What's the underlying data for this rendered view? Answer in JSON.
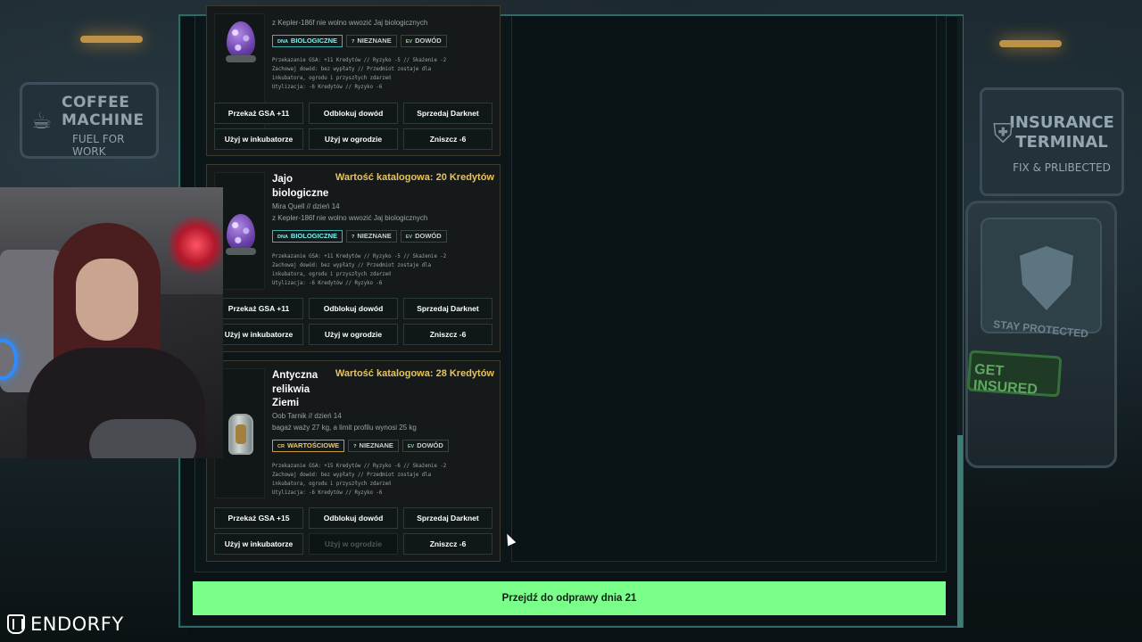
{
  "background": {
    "coffee_sign": {
      "line1": "COFFEE MACHINE",
      "line2": "FUEL FOR WORK"
    },
    "insurance_sign": {
      "line1": "INSURANCE",
      "line2": "TERMINAL",
      "line3": "FIX & PRLIBECTED"
    },
    "insurance_machine": {
      "stay": "STAY PROTECTED",
      "get": "GET INSURED"
    }
  },
  "brand": {
    "name": "ENDORFY"
  },
  "cards": [
    {
      "title": "",
      "value": "",
      "owner": "",
      "rule": "z Kepler-186f nie wolno wwozić Jaj biologicznych",
      "tags": [
        {
          "icon": "DNA",
          "label": "BIOLOGICZNE",
          "kind": "bio"
        },
        {
          "icon": "?",
          "label": "NIEZNANE",
          "kind": "unknown"
        },
        {
          "icon": "EV",
          "label": "DOWÓD",
          "kind": "ev"
        }
      ],
      "desc": [
        "Przekazanie GSA: +11 Kredytów // Ryzyko -5 // Skażenie -2",
        "Zachowaj dowód: bez wypłaty // Przedmiot zostaje dla",
        "inkubatora, ogrodu i przyszłych zdarzeń",
        "Utylizacja: -6 Kredytów // Ryzyko -6"
      ],
      "buttons": [
        {
          "label": "Przekaż GSA +11",
          "enabled": true
        },
        {
          "label": "Odblokuj dowód",
          "enabled": true
        },
        {
          "label": "Sprzedaj Darknet",
          "enabled": true
        },
        {
          "label": "Użyj w inkubatorze",
          "enabled": true
        },
        {
          "label": "Użyj w ogrodzie",
          "enabled": true
        },
        {
          "label": "Zniszcz -6",
          "enabled": true
        }
      ]
    },
    {
      "title": "Jajo biologiczne",
      "value": "Wartość katalogowa: 20 Kredytów",
      "owner": "Mira Quell // dzień 14",
      "rule": "z Kepler-186f nie wolno wwozić Jaj biologicznych",
      "tags": [
        {
          "icon": "DNA",
          "label": "BIOLOGICZNE",
          "kind": "bio"
        },
        {
          "icon": "?",
          "label": "NIEZNANE",
          "kind": "unknown"
        },
        {
          "icon": "EV",
          "label": "DOWÓD",
          "kind": "ev"
        }
      ],
      "desc": [
        "Przekazanie GSA: +11 Kredytów // Ryzyko -5 // Skażenie -2",
        "Zachowaj dowód: bez wypłaty // Przedmiot zostaje dla",
        "inkubatora, ogrodu i przyszłych zdarzeń",
        "Utylizacja: -6 Kredytów // Ryzyko -6"
      ],
      "buttons": [
        {
          "label": "Przekaż GSA +11",
          "enabled": true
        },
        {
          "label": "Odblokuj dowód",
          "enabled": true
        },
        {
          "label": "Sprzedaj Darknet",
          "enabled": true
        },
        {
          "label": "Użyj w inkubatorze",
          "enabled": true
        },
        {
          "label": "Użyj w ogrodzie",
          "enabled": true
        },
        {
          "label": "Zniszcz -6",
          "enabled": true
        }
      ]
    },
    {
      "title": "Antyczna relikwia Ziemi",
      "value": "Wartość katalogowa: 28 Kredytów",
      "owner": "Oob Tarnik // dzień 14",
      "rule": "bagaż waży 27 kg, a limit profilu wynosi 25 kg",
      "tags": [
        {
          "icon": "CR",
          "label": "WARTOŚCIOWE",
          "kind": "val"
        },
        {
          "icon": "?",
          "label": "NIEZNANE",
          "kind": "unknown"
        },
        {
          "icon": "EV",
          "label": "DOWÓD",
          "kind": "ev"
        }
      ],
      "desc": [
        "Przekazanie GSA: +15 Kredytów // Ryzyko -6 // Skażenie -2",
        "Zachowaj dowód: bez wypłaty // Przedmiot zostaje dla",
        "inkubatora, ogrodu i przyszłych zdarzeń",
        "Utylizacja: -6 Kredytów // Ryzyko -6"
      ],
      "buttons": [
        {
          "label": "Przekaż GSA +15",
          "enabled": true
        },
        {
          "label": "Odblokuj dowód",
          "enabled": true
        },
        {
          "label": "Sprzedaj Darknet",
          "enabled": true
        },
        {
          "label": "Użyj w inkubatorze",
          "enabled": true
        },
        {
          "label": "Użyj w ogrodzie",
          "enabled": false
        },
        {
          "label": "Zniszcz -6",
          "enabled": true
        }
      ]
    }
  ],
  "proceed_button": {
    "label": "Przejdź do odprawy dnia 21"
  }
}
